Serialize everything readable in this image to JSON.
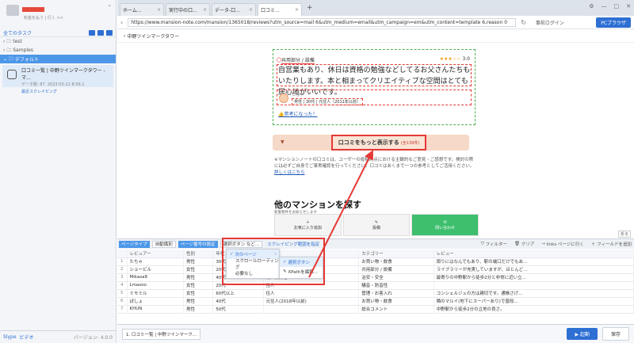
{
  "sidebar": {
    "subtitle": "料金を払う | 行く >>",
    "all_tasks": "全てのタスク",
    "tree": [
      {
        "label": "test"
      },
      {
        "label": "Samples"
      },
      {
        "label": "デフォルト"
      }
    ],
    "task": {
      "title": "口コミ一覧 | 中野ツインマークタワー - マ...",
      "meta": "データ数: 87",
      "date": "2023-03-22 8:56:1",
      "status": "最近スクレイピング"
    },
    "links": [
      "Slype",
      "ビデオ"
    ],
    "version": "バージョン: 4.0.0"
  },
  "tabs": [
    {
      "label": "ホーム..."
    },
    {
      "label": "実行中の口..."
    },
    {
      "label": "データ-口..."
    },
    {
      "label": "口コミ..."
    }
  ],
  "url": "https://www.mansion-note.com/mansion/1365018/reviews?utm_source=mail 6&utm_medium=email&utm_campaign=em&utm_content=template 6,reason 0",
  "url_actions": {
    "login": "事前ログイン",
    "browser": "PCブラウザ"
  },
  "site_head": "中野ツインマークタワー",
  "review": {
    "category_prefix": "〇",
    "category": "共用部分 / 設備",
    "stars": "★★★☆☆",
    "score": "3.0",
    "body": "自営業もあり、休日は資格の勉強などしてるお父さんたちもいたりします。本と相まってクリエイティブな空間はとても居心地がいいです。",
    "user_name": "たちゃ",
    "user_attr": "男性 | 30代 | 元住人（2011年以前）",
    "helpful": "参考になった！"
  },
  "more_button": {
    "label": "口コミをもっと表示する",
    "count": "(全139件)"
  },
  "notice": {
    "text": "※マンションノートの口コミは、ユーザーの投稿時点における主観的なご意見・ご感想です。検討の際には必ずご自身でご事実確認を行ってください。口コミはあくまで一つの参考としてご活用ください。",
    "link": "詳しくはこちら"
  },
  "other_title": "他のマンションを探す",
  "new_badge": "新着物件をお知らせします",
  "cards": [
    {
      "label": "お気に入り追加"
    },
    {
      "label": "投稿"
    },
    {
      "label": "問い合わせ"
    }
  ],
  "fold": "折る",
  "control": {
    "page_type": "ページタイプ",
    "page_type_val": "自動識別",
    "paging": "ページ番号の設定",
    "paging_val": "選択ボタン など...",
    "scroll": "スクレイピング範囲を指定",
    "filter": "フィルター",
    "clear": "クリア",
    "visit": "links ページに行く",
    "add_field": "フィールドを追加"
  },
  "menu1": [
    "次のページ",
    "スクロールローディング",
    "必要なし"
  ],
  "menu2": [
    "選択ボタン",
    "XPathを編集..."
  ],
  "table": {
    "headers": [
      "",
      "レビュアー",
      "性別",
      "年代",
      "身分",
      "カテゴリー",
      "レビュー"
    ],
    "rows": [
      [
        "1",
        "たちゃ",
        "男性",
        "30代",
        "元住人(2015年以前)",
        "お買い物・飲食",
        "周りにはなんでもあり、駅の端口だけでもあ..."
      ],
      [
        "2",
        "ショービル",
        "女性",
        "20代",
        "元住人(2018年以前)",
        "共用部分 / 設備",
        "ライブラリーが充実していますが、ほとんど..."
      ],
      [
        "3",
        "Mikasa8",
        "男性",
        "40代",
        "購入検討者",
        "治安・安全",
        "最寄りの中野駅から徒歩2分と非常に近い立..."
      ],
      [
        "4",
        "Lmasoo",
        "女性",
        "20代",
        "住人",
        "騒音・防音性",
        ""
      ],
      [
        "5",
        "ミモミル",
        "女性",
        "60代以上",
        "住人",
        "管理・お客入れ",
        "コンシェルジュの方は親切です。通帳さげ..."
      ],
      [
        "6",
        "ぽしょ",
        "男性",
        "40代",
        "元住人(2018年以前)",
        "お買い物・飲食",
        "隣のマルイ(地下にスーパーあり)で普段..."
      ],
      [
        "7",
        "KHUN",
        "男性",
        "50代",
        "",
        "総合コメント",
        "中野駅から徒歩2分の立地の良さ。"
      ]
    ]
  },
  "bottom": {
    "task": "1. 口コミ一覧 | 中野ツインマーク...",
    "run": "起動",
    "save": "保存"
  }
}
